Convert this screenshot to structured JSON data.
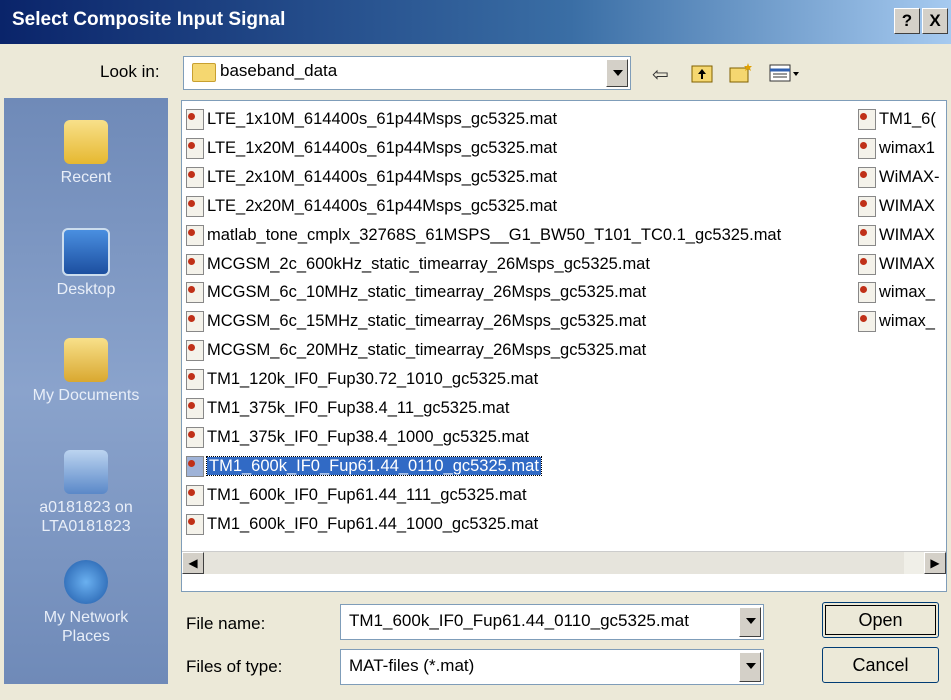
{
  "window": {
    "title": "Select Composite Input Signal",
    "help_label": "?",
    "close_label": "X"
  },
  "lookin": {
    "label": "Look in:",
    "value": "baseband_data",
    "toolbar_icons": [
      "back-icon",
      "up-folder-icon",
      "new-folder-icon",
      "view-menu-icon"
    ]
  },
  "places": [
    {
      "name": "Recent",
      "icon": "recent-folder-icon"
    },
    {
      "name": "Desktop",
      "icon": "desktop-icon"
    },
    {
      "name": "My Documents",
      "icon": "my-documents-icon"
    },
    {
      "name": "a0181823 on LTA0181823",
      "icon": "my-computer-icon"
    },
    {
      "name": "My Network Places",
      "icon": "network-places-icon"
    }
  ],
  "files_col1": [
    "LTE_1x10M_614400s_61p44Msps_gc5325.mat",
    "LTE_1x20M_614400s_61p44Msps_gc5325.mat",
    "LTE_2x10M_614400s_61p44Msps_gc5325.mat",
    "LTE_2x20M_614400s_61p44Msps_gc5325.mat",
    "matlab_tone_cmplx_32768S_61MSPS__G1_BW50_T101_TC0.1_gc5325.mat",
    "MCGSM_2c_600kHz_static_timearray_26Msps_gc5325.mat",
    "MCGSM_6c_10MHz_static_timearray_26Msps_gc5325.mat",
    "MCGSM_6c_15MHz_static_timearray_26Msps_gc5325.mat",
    "MCGSM_6c_20MHz_static_timearray_26Msps_gc5325.mat",
    "TM1_120k_IF0_Fup30.72_1010_gc5325.mat",
    "TM1_375k_IF0_Fup38.4_11_gc5325.mat",
    "TM1_375k_IF0_Fup38.4_1000_gc5325.mat",
    "TM1_600k_IF0_Fup61.44_0110_gc5325.mat",
    "TM1_600k_IF0_Fup61.44_111_gc5325.mat",
    "TM1_600k_IF0_Fup61.44_1000_gc5325.mat"
  ],
  "selected_index": 12,
  "files_col2": [
    "TM1_6(",
    "wimax1",
    "WiMAX-",
    "WIMAX",
    "WIMAX",
    "WIMAX",
    "wimax_",
    "wimax_"
  ],
  "filename": {
    "label": "File name:",
    "value": "TM1_600k_IF0_Fup61.44_0110_gc5325.mat"
  },
  "filetype": {
    "label": "Files of type:",
    "value": "MAT-files (*.mat)"
  },
  "buttons": {
    "open": "Open",
    "cancel": "Cancel"
  }
}
